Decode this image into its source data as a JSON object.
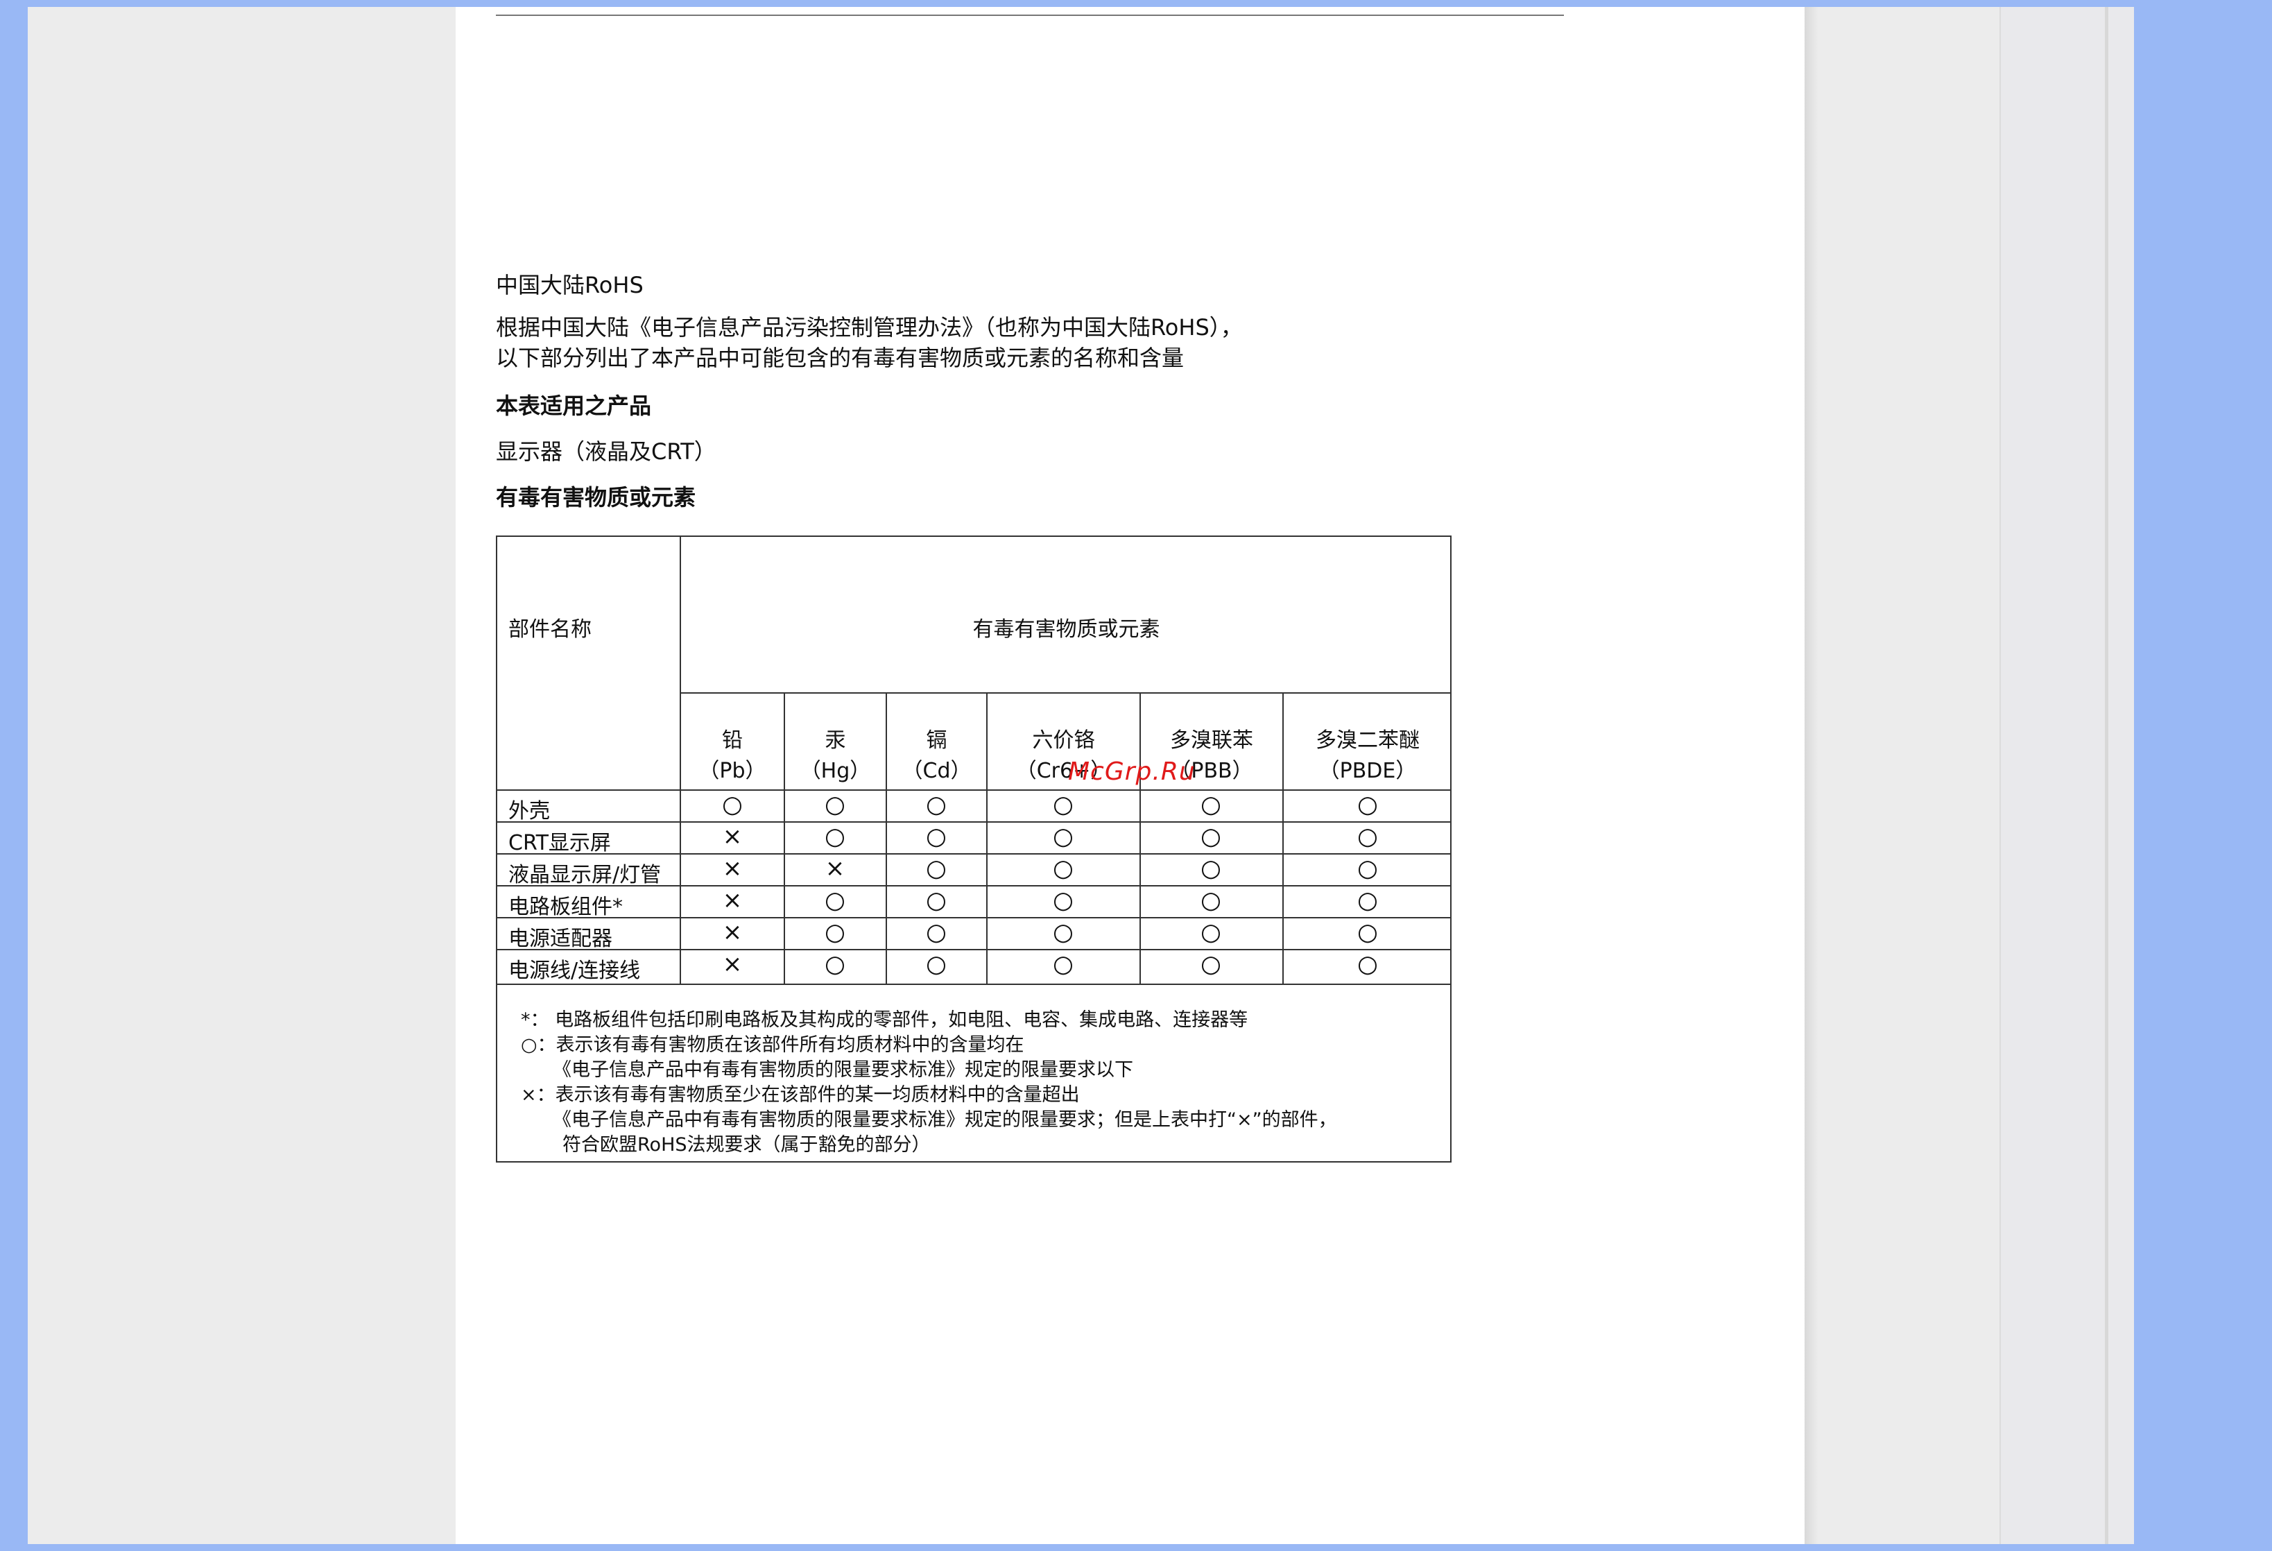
{
  "document": {
    "section_title": "中国大陆RoHS",
    "intro_line1": "根据中国大陆《电子信息产品污染控制管理办法》（也称为中国大陆RoHS），",
    "intro_line2": "以下部分列出了本产品中可能包含的有毒有害物质或元素的名称和含量",
    "applies_heading": "本表适用之产品",
    "product": "显示器（液晶及CRT）",
    "substances_heading": "有毒有害物质或元素"
  },
  "table": {
    "part_header": "部件名称",
    "group_header": "有毒有害物质或元素",
    "columns": [
      {
        "name": "铅",
        "symbol": "（Pb）"
      },
      {
        "name": "汞",
        "symbol": "（Hg）"
      },
      {
        "name": "镉",
        "symbol": "（Cd）"
      },
      {
        "name": "六价铬",
        "symbol": "（Cr6+）"
      },
      {
        "name": "多溴联苯",
        "symbol": "（PBB）"
      },
      {
        "name": "多溴二苯醚",
        "symbol": "（PBDE）"
      }
    ],
    "rows": [
      {
        "part": "外壳",
        "values": [
          "○",
          "○",
          "○",
          "○",
          "○",
          "○"
        ]
      },
      {
        "part": "CRT显示屏",
        "values": [
          "×",
          "○",
          "○",
          "○",
          "○",
          "○"
        ]
      },
      {
        "part": "液晶显示屏/灯管",
        "values": [
          "×",
          "×",
          "○",
          "○",
          "○",
          "○"
        ]
      },
      {
        "part": "电路板组件*",
        "values": [
          "×",
          "○",
          "○",
          "○",
          "○",
          "○"
        ]
      },
      {
        "part": "电源适配器",
        "values": [
          "×",
          "○",
          "○",
          "○",
          "○",
          "○"
        ]
      },
      {
        "part": "电源线/连接线",
        "values": [
          "×",
          "○",
          "○",
          "○",
          "○",
          "○"
        ]
      }
    ],
    "notes": [
      "*： 电路板组件包括印刷电路板及其构成的零部件，如电阻、电容、集成电路、连接器等",
      "○：表示该有毒有害物质在该部件所有均质材料中的含量均在",
      "《电子信息产品中有毒有害物质的限量要求标准》规定的限量要求以下",
      "×：表示该有毒有害物质至少在该部件的某一均质材料中的含量超出",
      "《电子信息产品中有毒有害物质的限量要求标准》规定的限量要求；但是上表中打“×”的部件，",
      "符合欧盟RoHS法规要求（属于豁免的部分）"
    ]
  },
  "watermark": "McGrp.Ru"
}
